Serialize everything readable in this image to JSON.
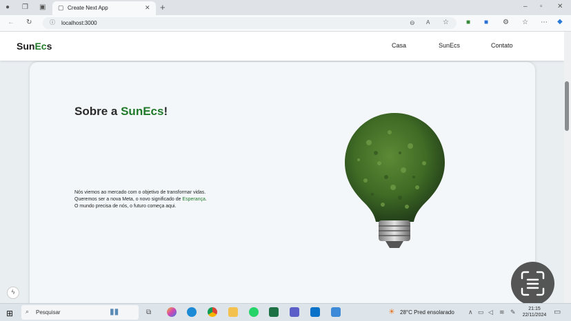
{
  "browser": {
    "tab_title": "Create Next App",
    "url": "localhost:3000"
  },
  "nav": {
    "logo_prefix": "Sun",
    "logo_highlight": "Ec",
    "logo_suffix": "s",
    "links": [
      "Casa",
      "SunEcs",
      "Contato"
    ]
  },
  "about": {
    "title_prefix": "Sobre a ",
    "title_brand": "SunEcs",
    "title_suffix": "!",
    "line1": "Nós viemos ao mercado com o objetivo de transformar vidas.",
    "line2_prefix": "Queremos ser a nova Meta, o novo significado de ",
    "line2_highlight": "Esperança",
    "line2_suffix": ".",
    "line3": "O mundo precisa de nós, o futuro começa aqui."
  },
  "taskbar": {
    "search_placeholder": "Pesquisar",
    "weather": "28°C  Pred ensolarado",
    "time": "21:15",
    "date": "22/11/2024"
  },
  "colors": {
    "brand_green": "#1f7a2a",
    "moss_green": "#3f6b25"
  },
  "icons": [
    "profile-icon",
    "workspaces-icon",
    "tab-actions-icon",
    "close-icon",
    "new-tab-icon",
    "back-icon",
    "refresh-icon",
    "info-icon",
    "zoom-icon",
    "read-aloud-icon",
    "favorite-icon",
    "extension-icon",
    "settings-menu-icon",
    "copilot-icon",
    "windows-start-icon",
    "visual-search-icon"
  ]
}
